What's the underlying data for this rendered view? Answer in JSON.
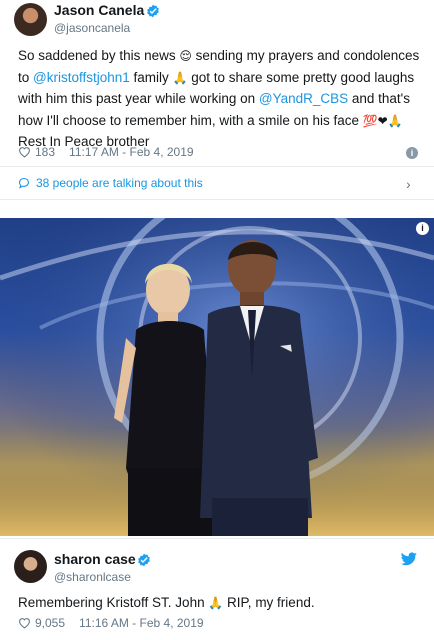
{
  "tweet1": {
    "name": "Jason Canela",
    "handle": "@jasoncanela",
    "text": {
      "p1": "So saddened by this news ",
      "p2": " sending my prayers and condolences to ",
      "mention1": "@kristoffstjohn1",
      "p3": " family ",
      "p4": " got to share some pretty good laughs with him this past year while working on ",
      "mention2": "@YandR_CBS",
      "p5": " and that's how I'll choose to remember him, with a smile on his face ",
      "p6": " Rest In Peace brother"
    },
    "likes": "183",
    "timestamp": "11:17 AM - Feb 4, 2019",
    "talking": "38 people are talking about this"
  },
  "tweet2": {
    "name": "sharon case",
    "handle": "@sharonlcase",
    "text": {
      "p1": "Remembering Kristoff ST. John ",
      "p2": " RIP, my friend."
    },
    "likes": "9,055",
    "timestamp": "11:16 AM - Feb 4, 2019"
  },
  "icons": {
    "verified": "verified-icon",
    "heart": "heart-icon",
    "info": "info-icon",
    "speech": "speech-bubble-icon",
    "chevron": "chevron-right-icon",
    "twitter": "twitter-bird-icon"
  },
  "colors": {
    "link": "#1b95e0",
    "muted": "#657786",
    "verified": "#1da1f2",
    "twitter": "#1da1f2"
  }
}
